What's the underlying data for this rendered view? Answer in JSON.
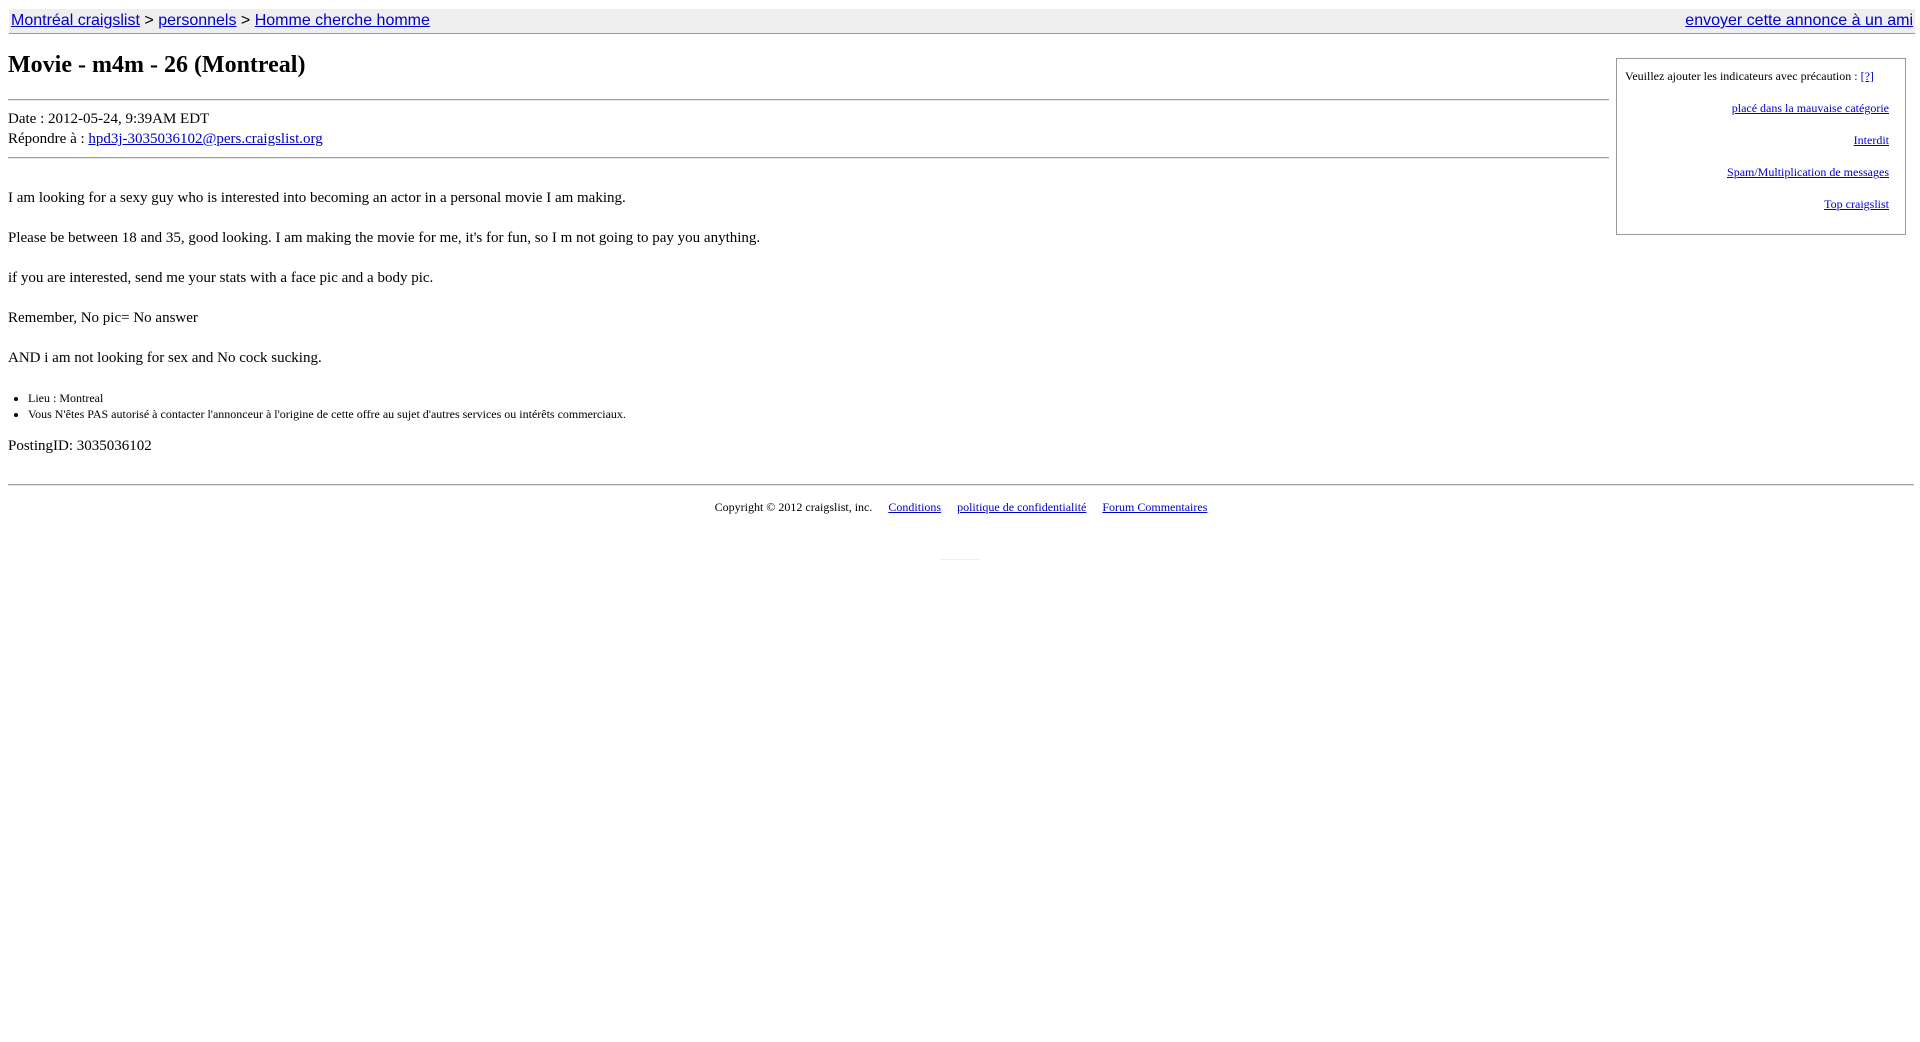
{
  "breadcrumb": {
    "site": "Montréal craigslist",
    "separator": ">",
    "section": "personnels",
    "category": "Homme cherche homme"
  },
  "share_link": "envoyer cette annonce à un ami",
  "posting": {
    "title": "Movie - m4m - 26 (Montreal)",
    "date_label": "Date :",
    "date_value": "2012-05-24, 9:39AM EDT",
    "reply_label": "Répondre à :",
    "reply_email": "hpd3j-3035036102@pers.craigslist.org",
    "paragraphs": [
      "I am looking for a sexy guy who is interested into becoming an actor in a personal movie I am making.",
      "Please be between 18 and 35, good looking. I am making the movie for me, it's for fun, so I m not going to pay you anything.",
      "if you are interested, send me your stats with a face pic and a body pic.",
      "Remember, No pic= No answer",
      "AND i am not looking for sex and No cock sucking."
    ],
    "notes": [
      "Lieu : Montreal",
      "Vous N'êtes PAS autorisé à contacter l'annonceur à l'origine de cette offre au sujet d'autres services ou intérêts commerciaux."
    ],
    "posting_id": "PostingID: 3035036102"
  },
  "flag_panel": {
    "heading": "Veuillez ajouter les indicateurs avec précaution :",
    "help_link": "[?]",
    "links": [
      "placé dans la mauvaise catégorie",
      "Interdit",
      "Spam/Multiplication de messages",
      "Top craigslist"
    ]
  },
  "footer": {
    "copyright": "Copyright © 2012 craigslist, inc.",
    "links": [
      "Conditions",
      "politique de confidentialité",
      "Forum Commentaires"
    ]
  },
  "colors": {
    "link": "#0000cc",
    "topbar_bg": "#eeeeee",
    "border": "#999999"
  }
}
